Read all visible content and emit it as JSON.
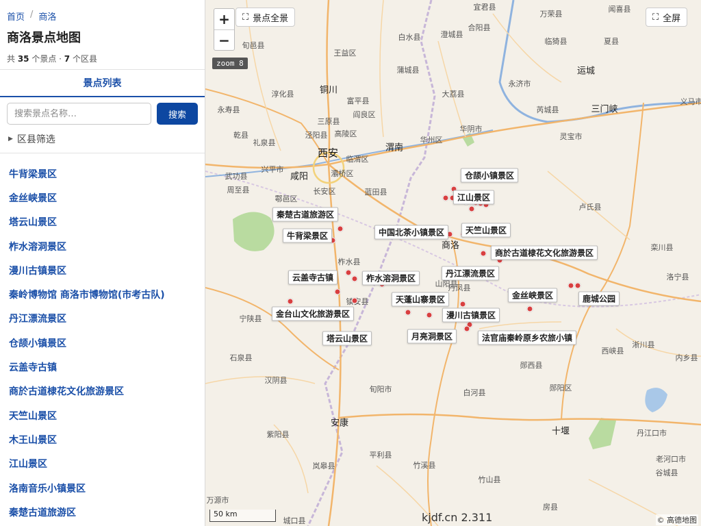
{
  "breadcrumb": {
    "home": "首页",
    "sep": "/",
    "current": "商洛"
  },
  "title": "商洛景点地图",
  "summary": {
    "prefix": "共 ",
    "spots": "35",
    "mid": " 个景点 · ",
    "districts": "7",
    "suffix": " 个区县"
  },
  "tab": "景点列表",
  "search": {
    "placeholder": "搜索景点名称…",
    "button": "搜索"
  },
  "filter": {
    "arrow": "▶",
    "label": "区县筛选"
  },
  "list": [
    "牛背梁景区",
    "金丝峡景区",
    "塔云山景区",
    "柞水溶洞景区",
    "漫川古镇景区",
    "秦岭博物馆 商洛市博物馆(市考古队)",
    "丹江漂流景区",
    "仓颉小镇景区",
    "云盖寺古镇",
    "商於古道棣花文化旅游景区",
    "天竺山景区",
    "木王山景区",
    "江山景区",
    "洛南音乐小镇景区",
    "秦楚古道旅游区"
  ],
  "map": {
    "zoom_in": "+",
    "zoom_out": "−",
    "zoom_badge": "zoom 8",
    "overview_btn": "景点全景",
    "fullscreen_btn": "全屏",
    "scale_label": "50 km",
    "watermark": "kjdf.cn 2.311",
    "attribution": "© 高德地图",
    "colors": {
      "land": "#f4f0e8",
      "road_major": "#f2b56b",
      "road_minor": "#f6d6a6",
      "river": "#8fb3df",
      "park": "#b9dba0",
      "spot": "#d84040"
    },
    "place_names": [
      "旬邑县",
      "铜川",
      "淳化县",
      "永寿县",
      "乾县",
      "礼泉县",
      "三原县",
      "富平县",
      "阎良区",
      "泾阳县",
      "高陵区",
      "蒲城县",
      "白水县",
      "澄城县",
      "合阳县",
      "大荔县",
      "华州区",
      "华阴市",
      "渭南",
      "临渭区",
      "西安",
      "咸阳",
      "兴平市",
      "武功县",
      "周至县",
      "鄠邑区",
      "灞桥区",
      "长安区",
      "蓝田县",
      "王益区",
      "柞水县",
      "镇安县",
      "山阳县",
      "丹凤县",
      "商洛",
      "宁陕县",
      "石泉县",
      "汉阴县",
      "旬阳市",
      "安康",
      "紫阳县",
      "岚皋县",
      "平利县",
      "竹溪县",
      "竹山县",
      "白河县",
      "郧西县",
      "郧阳区",
      "十堰",
      "丹江口市",
      "老河口市",
      "谷城县",
      "房县",
      "万源市",
      "城口县",
      "西峡县",
      "淅川县",
      "内乡县",
      "卢氏县",
      "栾川县",
      "洛宁县",
      "灵宝市",
      "三门峡",
      "运城",
      "临猗县",
      "永济市",
      "芮城县",
      "夏县",
      "闻喜县",
      "万荣县",
      "义马市",
      "宜君县"
    ],
    "callouts": [
      "仓颉小镇景区",
      "江山景区",
      "秦楚古道旅游区",
      "中国北茶小镇景区",
      "天竺山景区",
      "牛背梁景区",
      "商於古道棣花文化旅游景区",
      "丹江漂流景区",
      "云盖寺古镇",
      "柞水溶洞景区",
      "金丝峡景区",
      "鹿城公园",
      "天蓬山寨景区",
      "金台山文化旅游景区",
      "漫川古镇景区",
      "月亮洞景区",
      "法官庙秦岭原乡农旅小镇",
      "塔云山景区"
    ]
  }
}
